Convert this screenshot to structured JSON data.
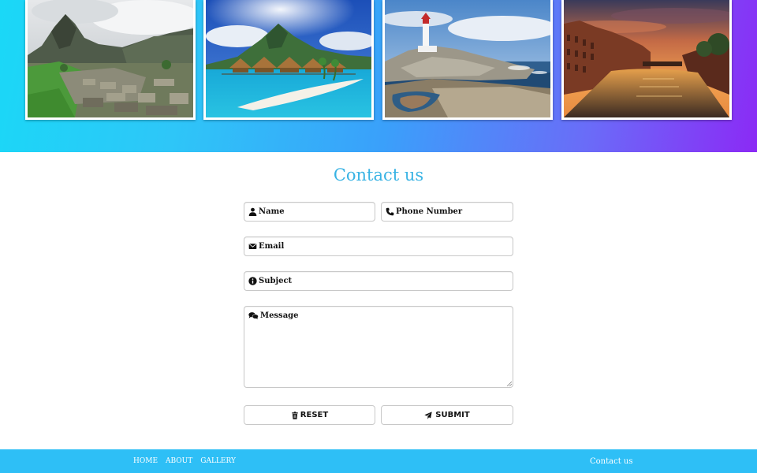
{
  "gallery": {
    "images": [
      {
        "icon": "mountain-ruins-photo"
      },
      {
        "icon": "tropical-island-photo"
      },
      {
        "icon": "lighthouse-coast-photo"
      },
      {
        "icon": "canal-sunset-photo"
      }
    ]
  },
  "contact": {
    "title": "Contact us",
    "fields": {
      "name": {
        "label": "Name",
        "icon": "user-icon"
      },
      "phone": {
        "label": "Phone Number",
        "icon": "phone-icon"
      },
      "email": {
        "label": "Email",
        "icon": "envelope-icon"
      },
      "subject": {
        "label": "Subject",
        "icon": "info-icon"
      },
      "message": {
        "label": "Message",
        "icon": "comments-icon"
      }
    },
    "buttons": {
      "reset": {
        "label": "RESET",
        "icon": "trash-icon"
      },
      "submit": {
        "label": "SUBMIT",
        "icon": "paper-plane-icon"
      }
    }
  },
  "footer": {
    "nav": [
      {
        "label": "HOME"
      },
      {
        "label": "ABOUT"
      },
      {
        "label": "GALLERY"
      }
    ],
    "contact_label": "Contact us"
  },
  "colors": {
    "accent": "#39b3e4",
    "footer_bg": "#2ebff6",
    "gradient_start": "#1ad8f7",
    "gradient_end": "#8b2af5"
  }
}
